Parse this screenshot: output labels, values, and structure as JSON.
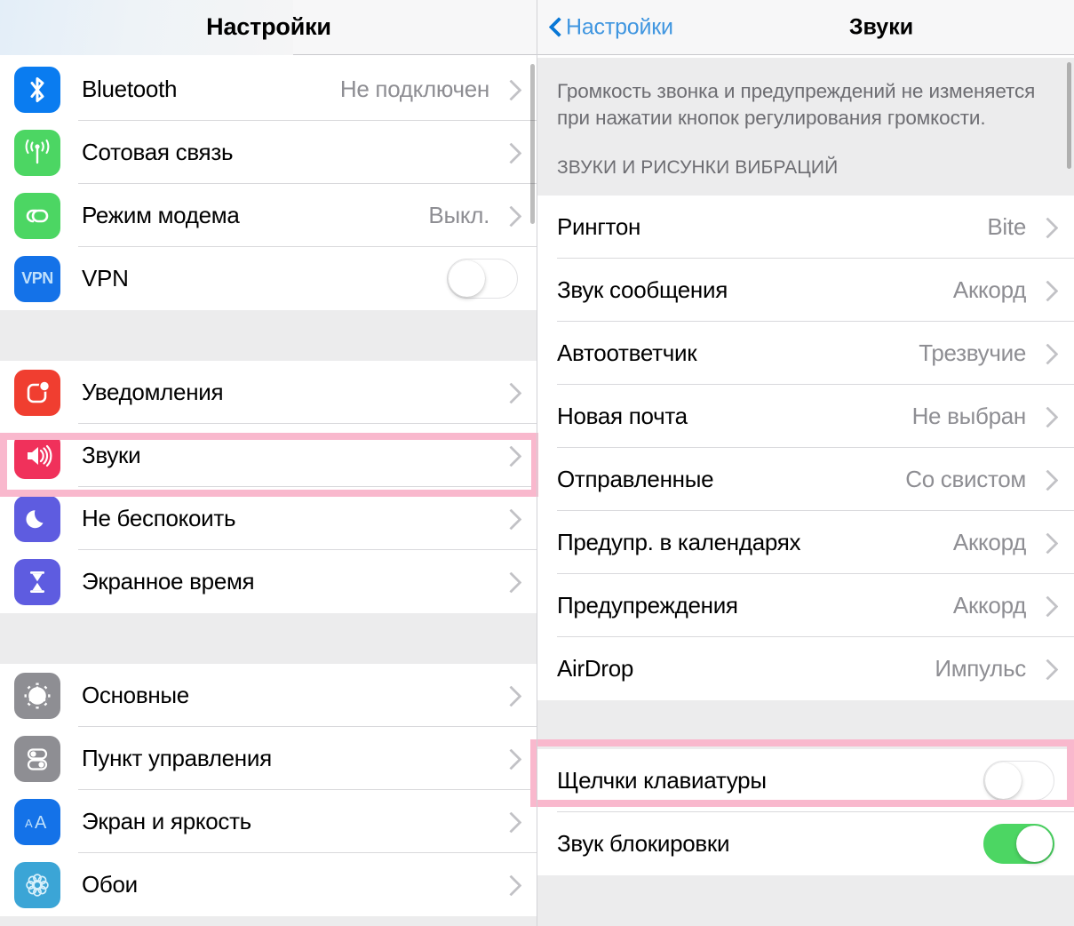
{
  "left_panel": {
    "nav": {
      "title": "Настройки"
    },
    "groups": [
      {
        "id": "connectivity",
        "rows": [
          {
            "label": "Bluetooth",
            "value": "Не подключен",
            "icon": "bluetooth-icon",
            "icon_color": "#0a7cf0",
            "accessory": "chevron"
          },
          {
            "label": "Сотовая связь",
            "value": "",
            "icon": "cellular-icon",
            "icon_color": "#4cd663",
            "accessory": "chevron"
          },
          {
            "label": "Режим модема",
            "value": "Выкл.",
            "icon": "hotspot-icon",
            "icon_color": "#4cd663",
            "accessory": "chevron"
          },
          {
            "label": "VPN",
            "value": "",
            "icon": "vpn-icon",
            "icon_color": "#1472e8",
            "accessory": "toggle",
            "toggle_on": false
          }
        ]
      },
      {
        "id": "alerts",
        "rows": [
          {
            "label": "Уведомления",
            "value": "",
            "icon": "notifications-icon",
            "icon_color": "#f03e30",
            "accessory": "chevron"
          },
          {
            "label": "Звуки",
            "value": "",
            "icon": "sounds-icon",
            "icon_color": "#f0315b",
            "accessory": "chevron",
            "highlighted": true
          },
          {
            "label": "Не беспокоить",
            "value": "",
            "icon": "moon-icon",
            "icon_color": "#5e5ce0",
            "accessory": "chevron"
          },
          {
            "label": "Экранное время",
            "value": "",
            "icon": "hourglass-icon",
            "icon_color": "#5e5ce0",
            "accessory": "chevron"
          }
        ]
      },
      {
        "id": "system",
        "rows": [
          {
            "label": "Основные",
            "value": "",
            "icon": "gear-icon",
            "icon_color": "#8e8e93",
            "accessory": "chevron"
          },
          {
            "label": "Пункт управления",
            "value": "",
            "icon": "control-center-icon",
            "icon_color": "#8e8e93",
            "accessory": "chevron"
          },
          {
            "label": "Экран и яркость",
            "value": "",
            "icon": "display-icon",
            "icon_color": "#1472e8",
            "accessory": "chevron"
          },
          {
            "label": "Обои",
            "value": "",
            "icon": "wallpaper-icon",
            "icon_color": "#3ba5d6",
            "accessory": "chevron"
          }
        ]
      }
    ]
  },
  "right_panel": {
    "nav": {
      "back_label": "Настройки",
      "title": "Звуки",
      "back_color": "#4096e0"
    },
    "note": "Громкость звонка и предупреждений не изменяется при нажатии кнопок регулирования громкости.",
    "section_header": "ЗВУКИ И РИСУНКИ ВИБРАЦИЙ",
    "sound_rows": [
      {
        "label": "Рингтон",
        "value": "Bite",
        "accessory": "chevron"
      },
      {
        "label": "Звук сообщения",
        "value": "Аккорд",
        "accessory": "chevron"
      },
      {
        "label": "Автоответчик",
        "value": "Трезвучие",
        "accessory": "chevron"
      },
      {
        "label": "Новая почта",
        "value": "Не выбран",
        "accessory": "chevron"
      },
      {
        "label": "Отправленные",
        "value": "Со свистом",
        "accessory": "chevron"
      },
      {
        "label": "Предупр. в календарях",
        "value": "Аккорд",
        "accessory": "chevron"
      },
      {
        "label": "Предупреждения",
        "value": "Аккорд",
        "accessory": "chevron"
      },
      {
        "label": "AirDrop",
        "value": "Импульс",
        "accessory": "chevron"
      }
    ],
    "toggle_rows": [
      {
        "label": "Щелчки клавиатуры",
        "accessory": "toggle",
        "toggle_on": false,
        "highlighted": true
      },
      {
        "label": "Звук блокировки",
        "accessory": "toggle",
        "toggle_on": true
      }
    ]
  },
  "highlight": {
    "color": "#f9b8cd",
    "targets": [
      "Звуки",
      "Щелчки клавиатуры"
    ]
  }
}
